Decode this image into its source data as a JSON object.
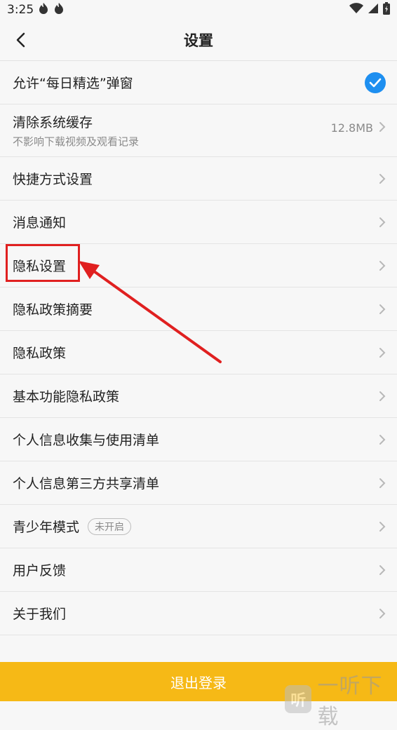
{
  "status": {
    "time": "3:25",
    "icons": [
      "flame-icon",
      "flame-icon"
    ],
    "right_icons": [
      "wifi-icon",
      "signal-icon",
      "battery-icon"
    ]
  },
  "header": {
    "title": "设置"
  },
  "settings": {
    "popup_allow": "允许“每日精选”弹窗",
    "clear_cache": {
      "label": "清除系统缓存",
      "sub": "不影响下载视频及观看记录",
      "value": "12.8MB"
    },
    "shortcut": "快捷方式设置",
    "notifications": "消息通知",
    "privacy_settings": "隐私设置",
    "privacy_summary": "隐私政策摘要",
    "privacy_policy": "隐私政策",
    "basic_privacy": "基本功能隐私政策",
    "info_collection": "个人信息收集与使用清单",
    "third_party": "个人信息第三方共享清单",
    "youth_mode": {
      "label": "青少年模式",
      "badge": "未开启"
    },
    "feedback": "用户反馈",
    "about": "关于我们"
  },
  "logout_label": "退出登录",
  "watermark": {
    "logo_char": "听",
    "text": "一听下载"
  },
  "colors": {
    "accent": "#1e8ff0",
    "logout": "#f6b916",
    "annotation": "#e02020"
  }
}
